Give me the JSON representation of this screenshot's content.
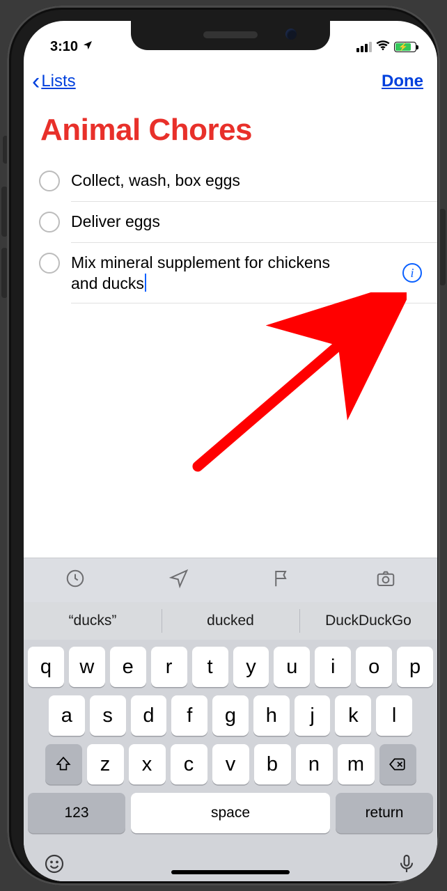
{
  "status": {
    "time": "3:10",
    "location_icon": "location-arrow"
  },
  "nav": {
    "back_label": "Lists",
    "done_label": "Done"
  },
  "list": {
    "title": "Animal Chores",
    "title_color": "#e8302a"
  },
  "tasks": [
    {
      "text": "Collect, wash, box eggs",
      "editing": false,
      "has_info": false
    },
    {
      "text": "Deliver eggs",
      "editing": false,
      "has_info": false
    },
    {
      "text": "Mix mineral supplement for chickens and ducks",
      "editing": true,
      "has_info": true
    }
  ],
  "toolbar_icons": [
    "clock-icon",
    "location-icon",
    "flag-icon",
    "camera-icon"
  ],
  "suggestions": [
    "“ducks”",
    "ducked",
    "DuckDuckGo"
  ],
  "keyboard": {
    "row1": [
      "q",
      "w",
      "e",
      "r",
      "t",
      "y",
      "u",
      "i",
      "o",
      "p"
    ],
    "row2": [
      "a",
      "s",
      "d",
      "f",
      "g",
      "h",
      "j",
      "k",
      "l"
    ],
    "row3": [
      "z",
      "x",
      "c",
      "v",
      "b",
      "n",
      "m"
    ],
    "key_123": "123",
    "key_space": "space",
    "key_return": "return"
  }
}
